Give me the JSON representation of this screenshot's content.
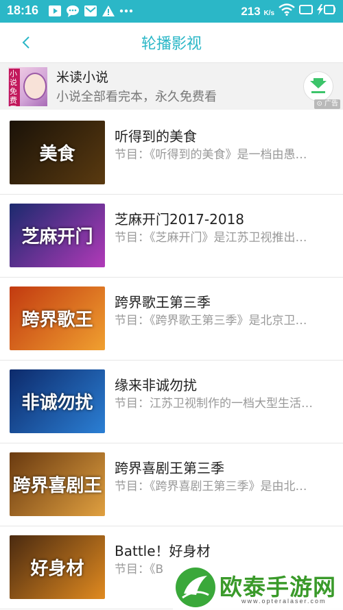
{
  "status_bar": {
    "time": "18:16",
    "speed_value": "213",
    "speed_unit": "K/s"
  },
  "nav": {
    "title": "轮播影视"
  },
  "ad": {
    "image_text": "小说免费看",
    "title": "米读小说",
    "subtitle": "小说全部看完本，永久免费看",
    "badge": "广告"
  },
  "items": [
    {
      "title": "听得到的美食",
      "desc": "节目：《听得到的美食》是一档由愚…",
      "thumb_text": "美食",
      "thumb_colors": [
        "#1a1208",
        "#5a3a10"
      ]
    },
    {
      "title": "芝麻开门2017-2018",
      "desc": "节目：《芝麻开门》是江苏卫视推出…",
      "thumb_text": "芝麻开门",
      "thumb_colors": [
        "#1b2a6e",
        "#b13ab8"
      ]
    },
    {
      "title": "跨界歌王第三季",
      "desc": "节目：《跨界歌王第三季》是北京卫…",
      "thumb_text": "跨界歌王",
      "thumb_colors": [
        "#c23a10",
        "#f0a030"
      ]
    },
    {
      "title": "缘来非诚勿扰",
      "desc": "节目：江苏卫视制作的一档大型生活…",
      "thumb_text": "非诚勿扰",
      "thumb_colors": [
        "#0d2a6b",
        "#2b7fd4"
      ]
    },
    {
      "title": "跨界喜剧王第三季",
      "desc": "节目：《跨界喜剧王第三季》是由北…",
      "thumb_text": "跨界喜剧王",
      "thumb_colors": [
        "#6a3a10",
        "#e0a040"
      ]
    },
    {
      "title": "Battle！好身材",
      "desc": "节目：《B",
      "thumb_text": "好身材",
      "thumb_colors": [
        "#4a2a10",
        "#e08a20"
      ]
    }
  ],
  "watermark": {
    "brand": "欧泰手游网",
    "url": "www.opteralaser.com"
  }
}
